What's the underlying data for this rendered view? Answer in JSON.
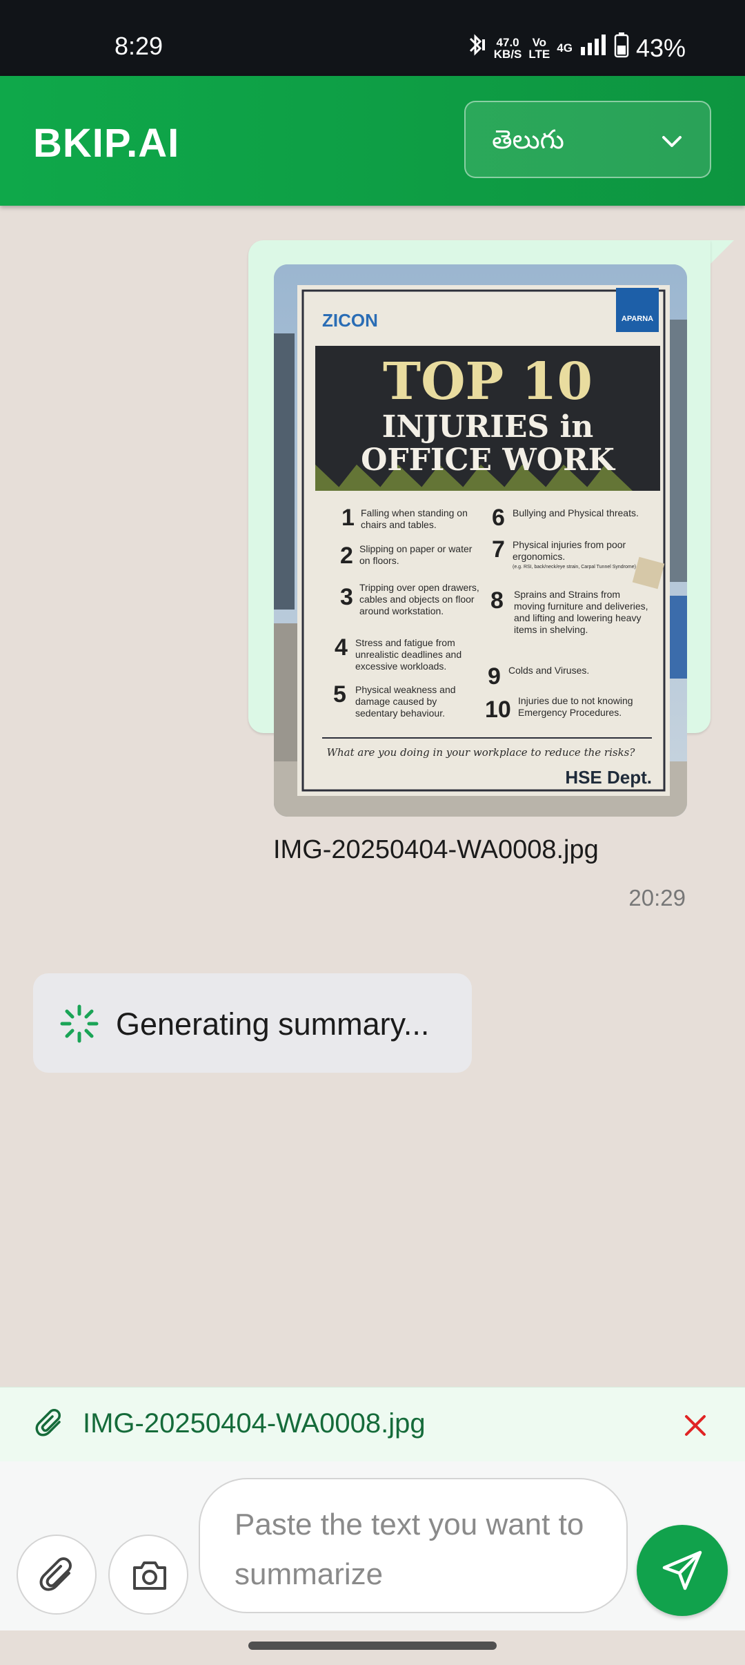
{
  "status_bar": {
    "time": "8:29",
    "data_rate_value": "47.0",
    "data_rate_unit": "KB/S",
    "volte_line1": "Vo",
    "volte_line2": "LTE",
    "network": "4G",
    "battery": "43%"
  },
  "header": {
    "brand": "BKIP.AI",
    "language_selected": "తెలుగు",
    "accent_color": "#0fa84a"
  },
  "messages": {
    "outgoing": {
      "file_name": "IMG-20250404-WA0008.jpg",
      "time": "20:29",
      "poster": {
        "logo_left": "ZICON",
        "logo_right": "APARNA",
        "title_line1": "TOP 10",
        "title_line2": "INJURIES in",
        "title_line3": "OFFICE WORK",
        "items": [
          {
            "num": "1",
            "text": "Falling when standing on chairs and tables."
          },
          {
            "num": "2",
            "text": "Slipping on paper or water on floors."
          },
          {
            "num": "3",
            "text": "Tripping over open drawers, cables and objects on floor around workstation."
          },
          {
            "num": "4",
            "text": "Stress and fatigue from unrealistic deadlines and excessive workloads."
          },
          {
            "num": "5",
            "text": "Physical weakness and damage caused by sedentary behaviour."
          },
          {
            "num": "6",
            "text": "Bullying and Physical threats."
          },
          {
            "num": "7",
            "text": "Physical injuries from poor ergonomics."
          },
          {
            "num": "8",
            "text": "Sprains and Strains from moving furniture and deliveries, and lifting and lowering heavy items in shelving."
          },
          {
            "num": "9",
            "text": "Colds and Viruses."
          },
          {
            "num": "10",
            "text": "Injuries due to not knowing Emergency Procedures."
          }
        ],
        "item7_note": "(e.g. RSI, back/neck/eye strain, Carpal Tunnel Syndrome)",
        "footer_question": "What are you doing in your workplace to reduce the risks?",
        "footer_dept": "HSE Dept."
      }
    },
    "incoming": {
      "status_text": "Generating summary..."
    }
  },
  "attachment": {
    "file_name": "IMG-20250404-WA0008.jpg"
  },
  "composer": {
    "placeholder": "Paste the text you want to summarize"
  }
}
